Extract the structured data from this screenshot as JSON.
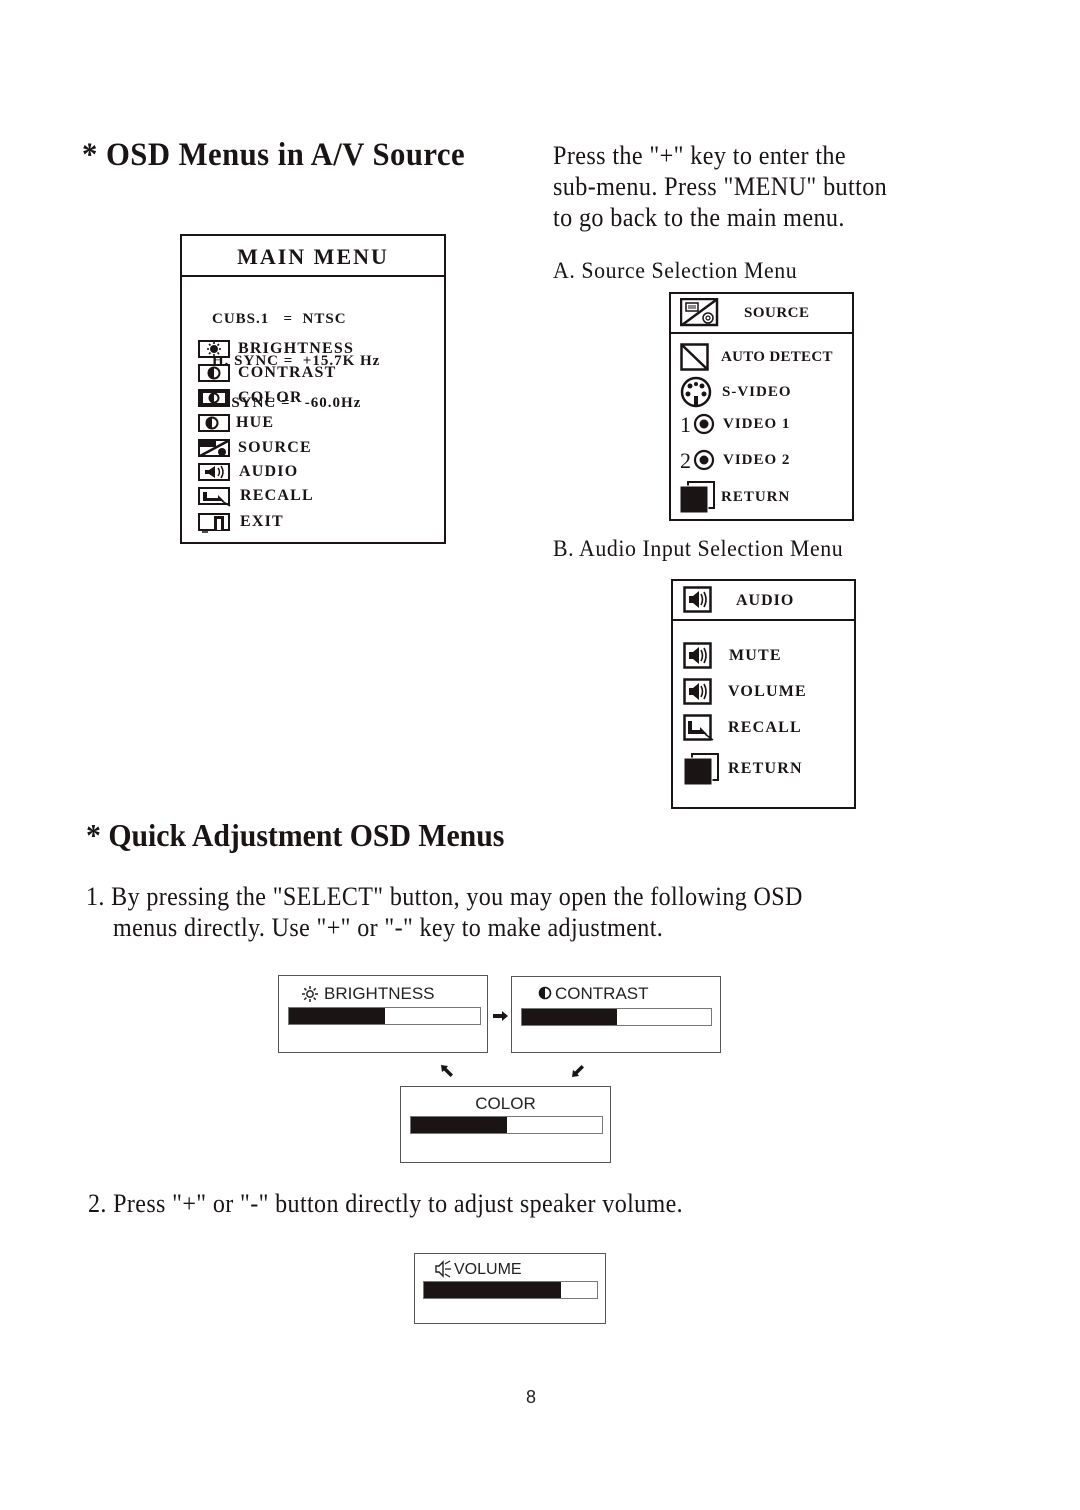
{
  "section1": {
    "title": "* OSD Menus in A/V Source",
    "intro_lines": [
      "Press the \"+\" key to enter the",
      "sub-menu. Press \"MENU\" button",
      "to go back to the main menu."
    ],
    "main_menu": {
      "title": "MAIN MENU",
      "info_lines": [
        "CUBS.1   =  NTSC",
        "H. SYNC =  +15.7K Hz",
        "V. SYNC =   -60.0Hz"
      ],
      "items": [
        {
          "label": "BRIGHTNESS",
          "icon": "brightness-icon"
        },
        {
          "label": "CONTRAST",
          "icon": "contrast-icon"
        },
        {
          "label": "COLOR",
          "icon": "color-icon"
        },
        {
          "label": "HUE",
          "icon": "hue-icon"
        },
        {
          "label": "SOURCE",
          "icon": "source-icon"
        },
        {
          "label": "AUDIO",
          "icon": "speaker-icon"
        },
        {
          "label": "RECALL",
          "icon": "recall-icon"
        },
        {
          "label": "EXIT",
          "icon": "exit-icon"
        }
      ]
    },
    "source_menu": {
      "caption": "A. Source Selection Menu",
      "title": "SOURCE",
      "items": [
        {
          "label": "AUTO DETECT",
          "icon": "auto-detect-icon"
        },
        {
          "label": "S-VIDEO",
          "icon": "s-video-connector-icon"
        },
        {
          "label": "VIDEO 1",
          "icon": "video-1-connector-icon"
        },
        {
          "label": "VIDEO 2",
          "icon": "video-2-connector-icon"
        },
        {
          "label": "RETURN",
          "icon": "return-icon"
        }
      ]
    },
    "audio_menu": {
      "caption": "B. Audio Input Selection Menu",
      "title": "AUDIO",
      "items": [
        {
          "label": "MUTE",
          "icon": "speaker-icon"
        },
        {
          "label": "VOLUME",
          "icon": "speaker-icon"
        },
        {
          "label": "RECALL",
          "icon": "recall-icon"
        },
        {
          "label": "RETURN",
          "icon": "return-icon"
        }
      ]
    }
  },
  "section2": {
    "title": "* Quick Adjustment OSD Menus",
    "step1_lines": [
      "1. By pressing the \"SELECT\" button, you may open the following OSD",
      "menus directly. Use \"+\" or \"-\" key to make adjustment."
    ],
    "quick_menus": [
      {
        "label": "BRIGHTNESS",
        "icon": "sun-icon",
        "level_percent": 50
      },
      {
        "label": "CONTRAST",
        "icon": "half-circle-icon",
        "level_percent": 50
      },
      {
        "label": "COLOR",
        "icon": "",
        "level_percent": 50
      }
    ],
    "step2_line": "2. Press \"+\" or \"-\" button directly to adjust speaker volume.",
    "volume_menu": {
      "label": "VOLUME",
      "icon": "speaker-icon",
      "level_percent": 79
    }
  },
  "page_number": "8"
}
